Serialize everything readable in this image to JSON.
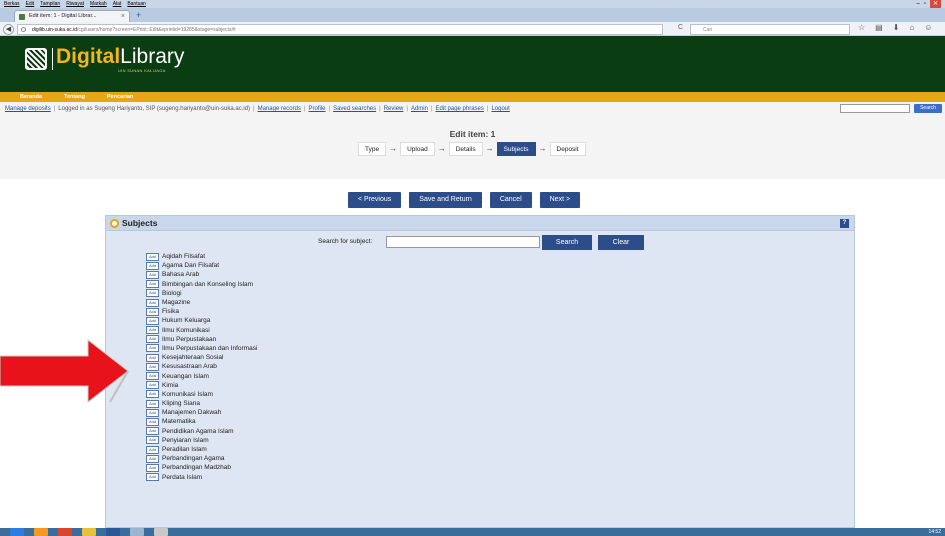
{
  "browser": {
    "menu": [
      "Berkas",
      "Edit",
      "Tampilan",
      "Riwayat",
      "Markah",
      "Alat",
      "Bantuan"
    ],
    "tab_title": "Edit item: 1 - Digital Librar...",
    "url_host": "digilib.uin-suka.ac.id",
    "url_path": "/cgi/users/home?screen=EPrint::Edit&eprintid=19285&stage=subjects#t",
    "search_placeholder": "Cari"
  },
  "site": {
    "logo_digital": "Digital",
    "logo_library": "Library",
    "logo_subtitle": "UIN SUNAN KALIJAGA",
    "nav": [
      "Beranda",
      "Tentang",
      "Pencarian"
    ]
  },
  "user_bar": {
    "manage_deposits": "Manage deposits",
    "logged_in": "Logged in as Sugeng Hariyanto, SIP (sugeng.hariyanto@uin-suka.ac.id)",
    "links": [
      "Manage records",
      "Profile",
      "Saved searches",
      "Review",
      "Admin",
      "Edit page phrases",
      "Logout"
    ],
    "search_button": "Search"
  },
  "edit": {
    "title": "Edit item: 1",
    "steps": [
      "Type",
      "Upload",
      "Details",
      "Subjects",
      "Deposit"
    ],
    "active_step": "Subjects",
    "actions": [
      "< Previous",
      "Save and Return",
      "Cancel",
      "Next >"
    ]
  },
  "subjects": {
    "panel_title": "Subjects",
    "search_label": "Search for subject:",
    "search_button": "Search",
    "clear_button": "Clear",
    "add_label": "Add",
    "items": [
      "Aqidah Filsafat",
      "Agama Dan Filsafat",
      "Bahasa Arab",
      "Bimbingan dan Konseling Islam",
      "Biologi",
      "Magazine",
      "Fisika",
      "Hukum Keluarga",
      "Ilmu Komunikasi",
      "Ilmu Perpustakaan",
      "Ilmu Perpustakaan dan Informasi",
      "Kesejahteraan Sosial",
      "Kesusastraan Arab",
      "Keuangan Islam",
      "Kimia",
      "Komunikasi Islam",
      "Kliping Siana",
      "Manajemen Dakwah",
      "Matematika",
      "Pendidikan Agama Islam",
      "Penyiaran Islam",
      "Peradilan Islam",
      "Perbandingan Agama",
      "Perbandingan Madzhab",
      "Perdata Islam"
    ]
  },
  "colors": {
    "header_green": "#0b3d12",
    "nav_orange": "#e8a516",
    "button_blue": "#2c4c8a",
    "arrow_red": "#e8121a"
  },
  "taskbar": {
    "time": "14:52"
  }
}
